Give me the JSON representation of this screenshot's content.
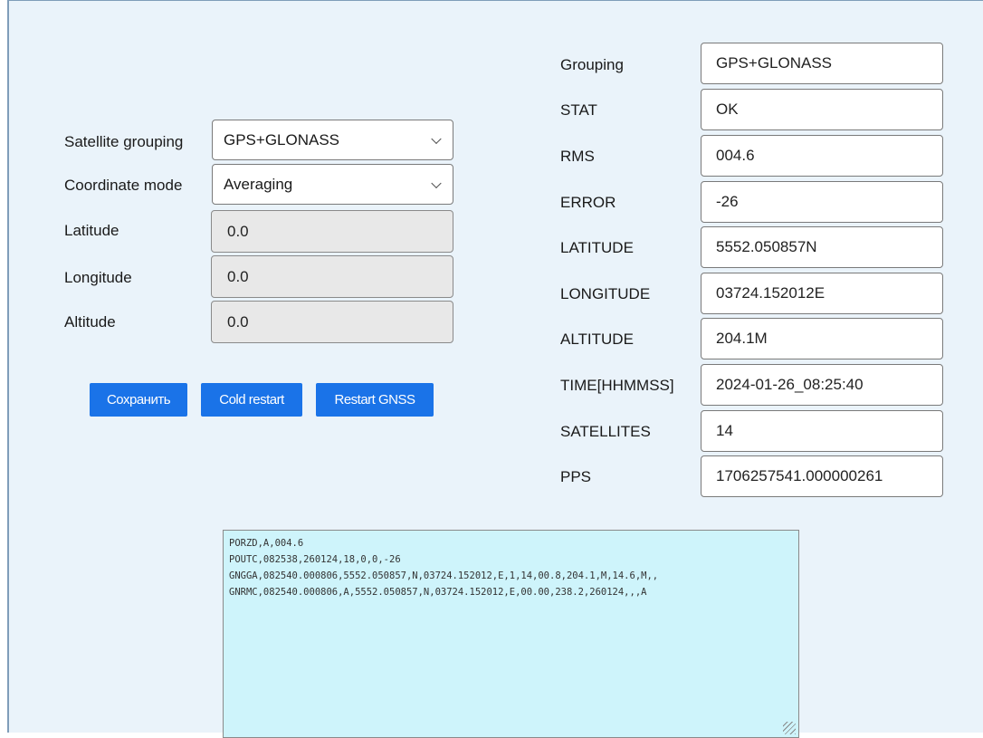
{
  "left": {
    "satellite_grouping": {
      "label": "Satellite grouping",
      "value": "GPS+GLONASS"
    },
    "coordinate_mode": {
      "label": "Coordinate mode",
      "value": "Averaging"
    },
    "latitude": {
      "label": "Latitude",
      "value": "0.0"
    },
    "longitude": {
      "label": "Longitude",
      "value": "0.0"
    },
    "altitude": {
      "label": "Altitude",
      "value": "0.0"
    },
    "buttons": {
      "save": "Сохранить",
      "cold_restart": "Cold restart",
      "restart_gnss": "Restart GNSS"
    }
  },
  "status": [
    {
      "label": "Grouping",
      "value": "GPS+GLONASS"
    },
    {
      "label": "STAT",
      "value": "OK"
    },
    {
      "label": "RMS",
      "value": "004.6"
    },
    {
      "label": "ERROR",
      "value": "-26"
    },
    {
      "label": "LATITUDE",
      "value": "5552.050857N"
    },
    {
      "label": "LONGITUDE",
      "value": "03724.152012E"
    },
    {
      "label": "ALTITUDE",
      "value": "204.1M"
    },
    {
      "label": "TIME[HHMMSS]",
      "value": "2024-01-26_08:25:40"
    },
    {
      "label": "SATELLITES",
      "value": "14"
    },
    {
      "label": "PPS",
      "value": "1706257541.000000261"
    }
  ],
  "log": {
    "lines": [
      "PORZD,A,004.6",
      "POUTC,082538,260124,18,0,0,-26",
      "GNGGA,082540.000806,5552.050857,N,03724.152012,E,1,14,00.8,204.1,M,14.6,M,,",
      "GNRMC,082540.000806,A,5552.050857,N,03724.152012,E,00.00,238.2,260124,,,A"
    ]
  }
}
